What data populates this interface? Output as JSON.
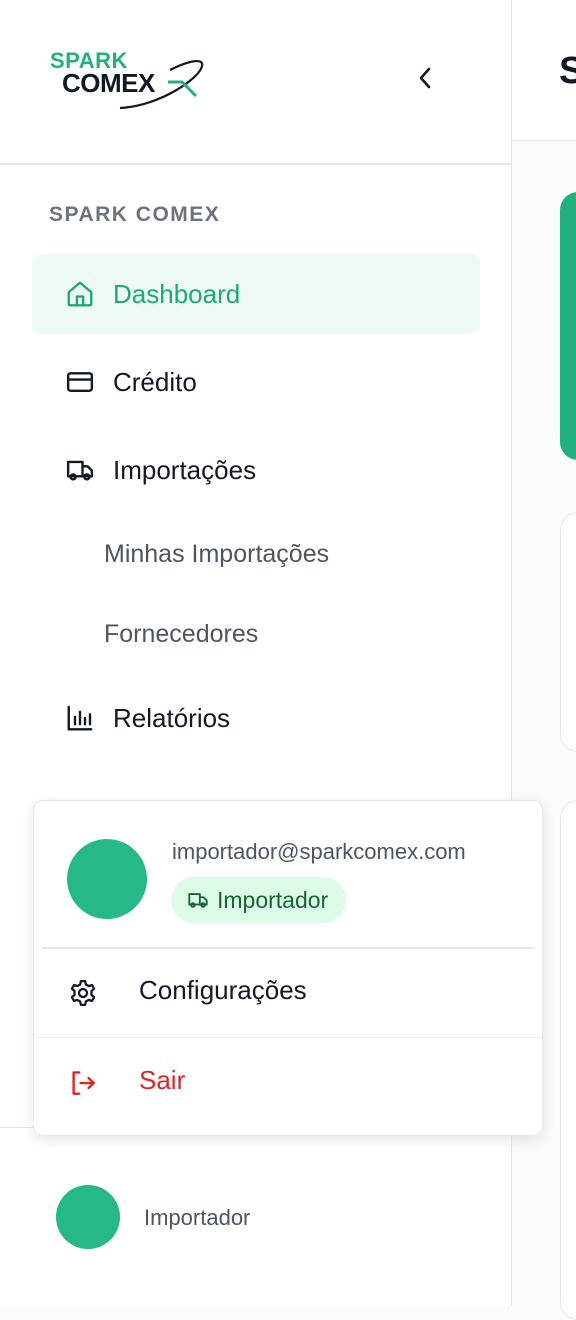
{
  "brand": {
    "logo_line1": "SPARK",
    "logo_line2": "COMEX",
    "primary_color": "#22b07d",
    "accent_color": "#20a873"
  },
  "header": {
    "collapse_icon": "chevron-left-icon",
    "main_title_partial": "S"
  },
  "sidebar": {
    "section_label": "SPARK COMEX",
    "items": [
      {
        "label": "Dashboard",
        "icon": "home-icon",
        "active": true
      },
      {
        "label": "Crédito",
        "icon": "credit-card-icon",
        "active": false
      },
      {
        "label": "Importações",
        "icon": "truck-icon",
        "active": false,
        "children": [
          {
            "label": "Minhas Importações"
          },
          {
            "label": "Fornecedores"
          }
        ]
      },
      {
        "label": "Relatórios",
        "icon": "bar-chart-icon",
        "active": false
      }
    ]
  },
  "user_menu": {
    "email": "importador@sparkcomex.com",
    "role": "Importador",
    "role_icon": "truck-icon",
    "settings_label": "Configurações",
    "settings_icon": "gear-icon",
    "logout_label": "Sair",
    "logout_icon": "logout-icon",
    "logout_color": "#dc2626"
  },
  "footer": {
    "role": "Importador"
  }
}
